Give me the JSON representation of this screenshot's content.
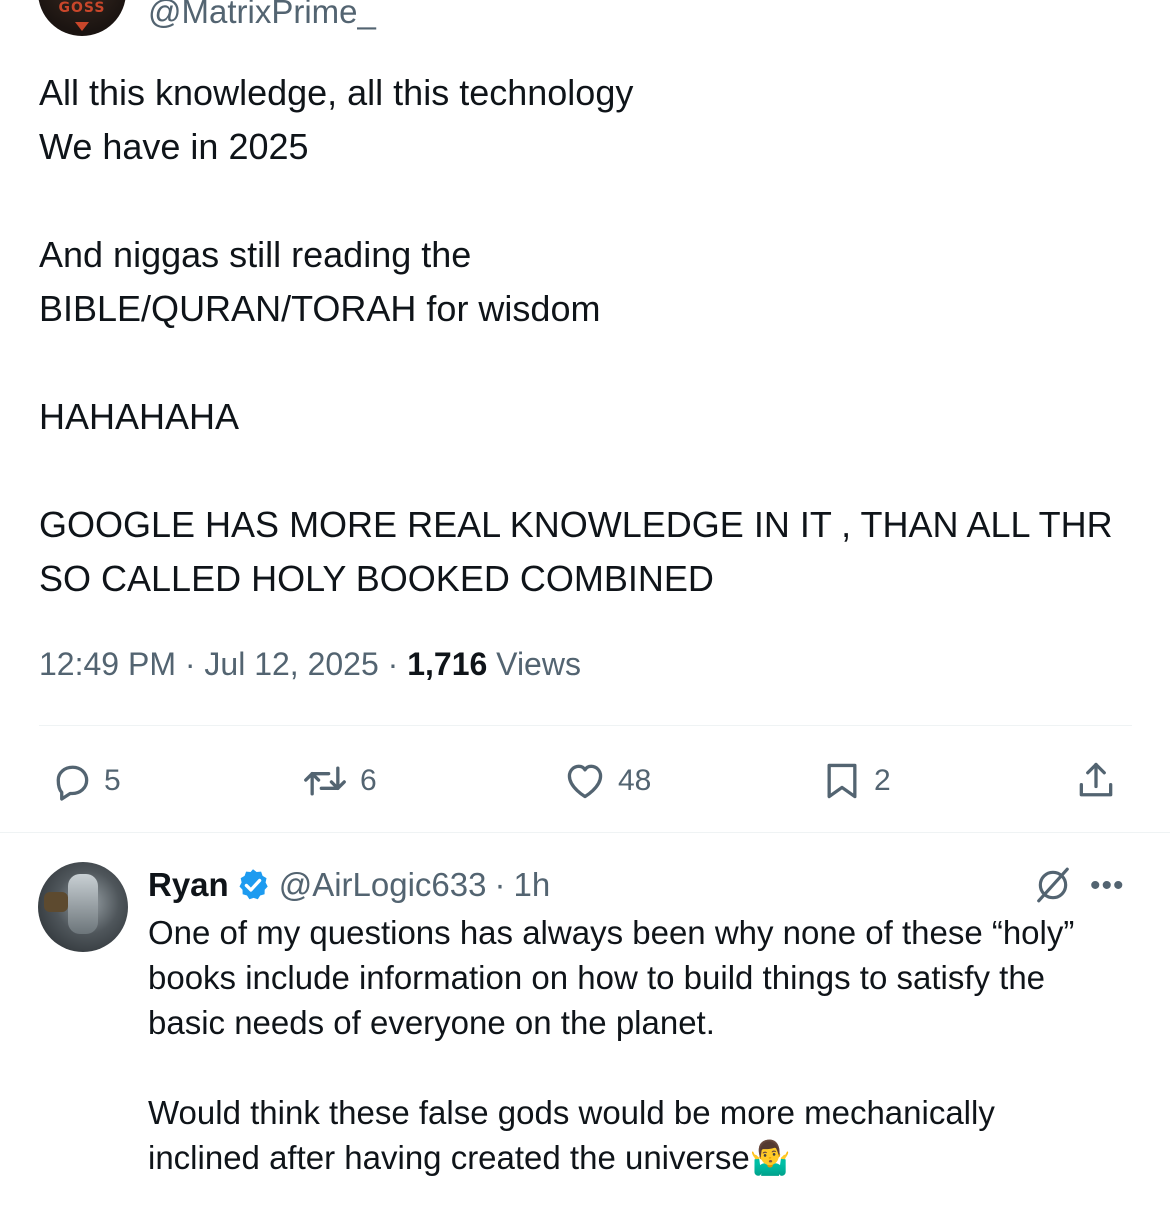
{
  "original_tweet": {
    "avatar_logo_text": "GOSS",
    "handle": "@MatrixPrime_",
    "paragraphs": [
      [
        "All this knowledge, all this technology",
        "We have in 2025"
      ],
      [
        "And niggas still reading the",
        "BIBLE/QURAN/TORAH for wisdom"
      ],
      [
        "HAHAHAHA"
      ],
      [
        "GOOGLE HAS MORE REAL KNOWLEDGE IN IT , THAN ALL THR",
        "SO CALLED HOLY BOOKED COMBINED"
      ]
    ],
    "time": "12:49 PM",
    "separator": "·",
    "date": "Jul 12, 2025",
    "views_count": "1,716",
    "views_label": "Views",
    "actions": {
      "replies": "5",
      "reposts": "6",
      "likes": "48",
      "bookmarks": "2"
    }
  },
  "reply": {
    "name": "Ryan",
    "handle": "@AirLogic633",
    "separator": "·",
    "time_ago": "1h",
    "paragraphs": [
      [
        "One of my questions has always been why none of these “holy”",
        "books include information on how to build things to satisfy the",
        "basic needs of everyone on the planet."
      ],
      [
        "Would think these false gods would be more mechanically",
        "inclined after having created the universe🤷‍♂️"
      ]
    ]
  },
  "icons": {
    "reply": "reply-icon",
    "repost": "repost-icon",
    "like": "heart-icon",
    "bookmark": "bookmark-icon",
    "share": "share-icon",
    "verified": "verified-badge-icon",
    "grok": "grok-icon",
    "more": "more-icon"
  },
  "colors": {
    "text": "#0f1419",
    "muted": "#536471",
    "verified": "#1d9bf0",
    "divider": "#eff3f4"
  }
}
